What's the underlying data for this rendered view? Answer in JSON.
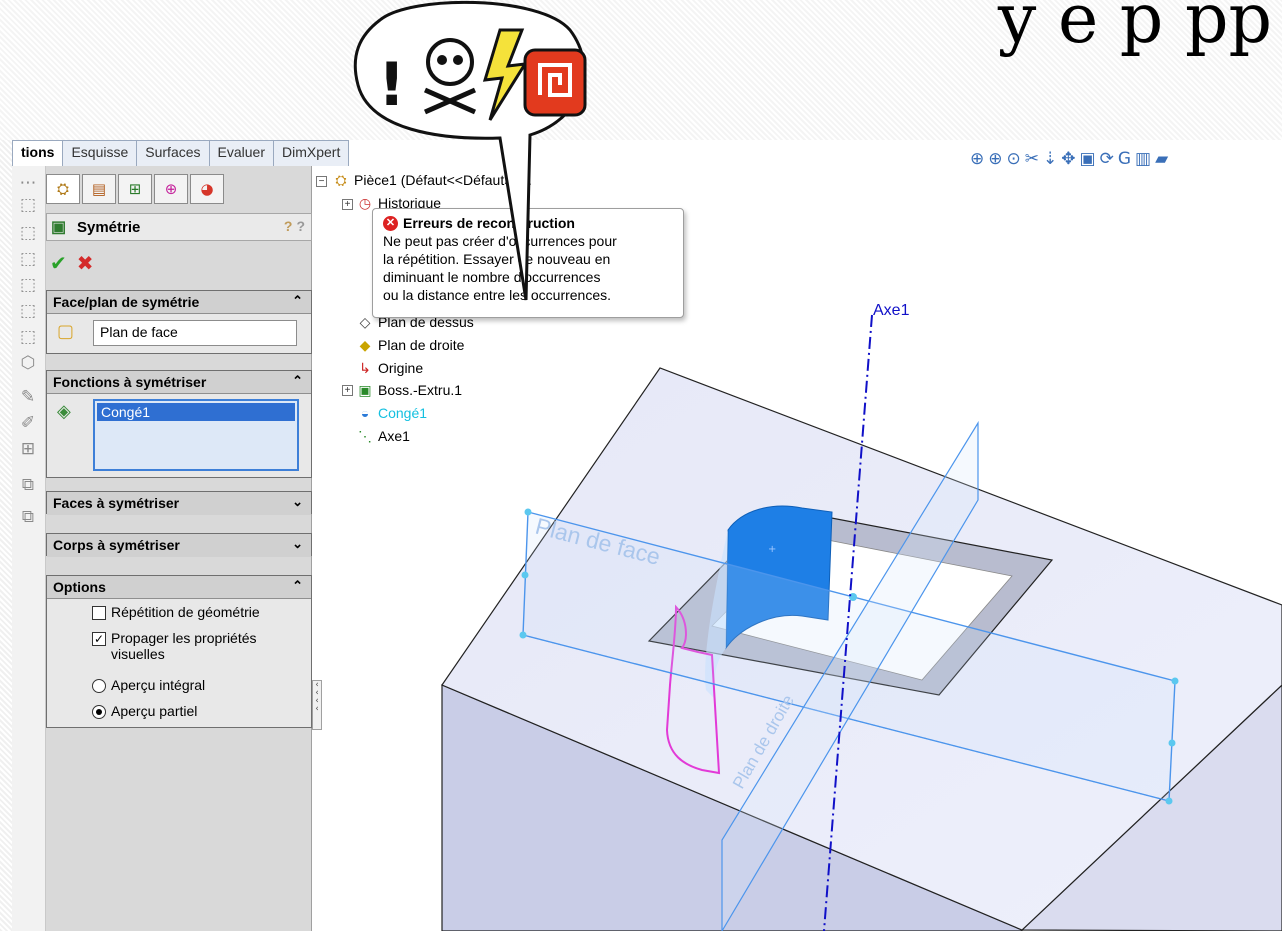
{
  "slide": {
    "title_fragment": "y e  p  pp"
  },
  "tabs": [
    "tions",
    "Esquisse",
    "Surfaces",
    "Evaluer",
    "DimXpert"
  ],
  "property_manager": {
    "title": "Symétrie",
    "help": "?",
    "groups": {
      "mirror_face": {
        "header": "Face/plan de symétrie",
        "value": "Plan de face"
      },
      "features": {
        "header": "Fonctions à symétriser",
        "items": [
          "Congé1"
        ]
      },
      "faces": {
        "header": "Faces à symétriser"
      },
      "bodies": {
        "header": "Corps à symétriser"
      },
      "options": {
        "header": "Options",
        "geometry_pattern": "Répétition de géométrie",
        "propagate": "Propager les propriétés visuelles",
        "full_preview": "Aperçu intégral",
        "partial_preview": "Aperçu partiel"
      }
    }
  },
  "tree": {
    "root": "Pièce1  (Défaut<<Défaut>_...",
    "items": [
      "Historique",
      "Plan de dessus",
      "Plan de droite",
      "Origine",
      "Boss.-Extru.1",
      "Congé1",
      "Axe1"
    ]
  },
  "tooltip": {
    "title": "Erreurs de reconstruction",
    "lines": [
      "Ne peut pas créer d'occurrences pour",
      "la répétition. Essayer de nouveau en",
      "diminuant le nombre d'occurrences",
      "ou la distance entre les occurrences."
    ]
  },
  "viewport": {
    "axis_label": "Axe1",
    "plane_front": "Plan de face",
    "plane_right": "Plan de droite"
  },
  "colors": {
    "accent_blue": "#1e7fe6",
    "axis_blue": "#1010c8",
    "error_red": "#d22222",
    "sketch_magenta": "#e23ad7",
    "tree_highlight": "#14c0e0"
  }
}
